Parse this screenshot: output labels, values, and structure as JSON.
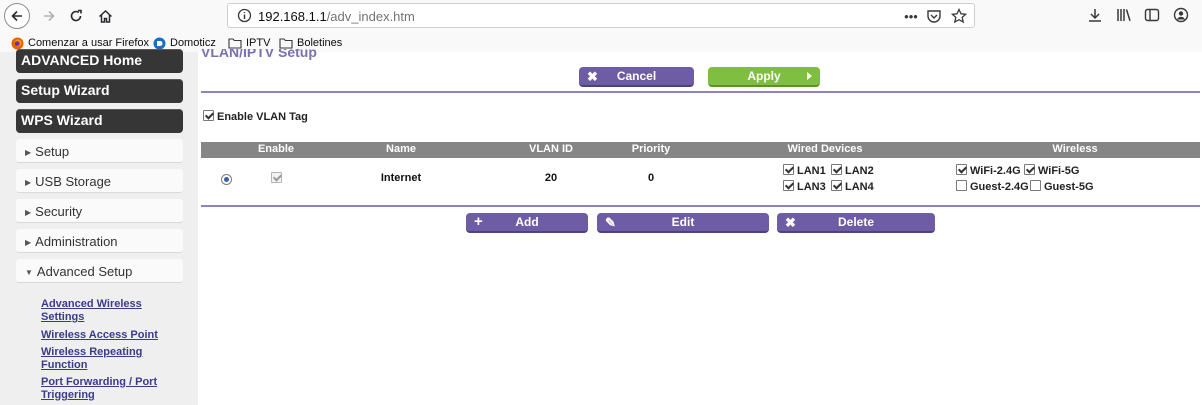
{
  "browser": {
    "url_host": "192.168.1.1",
    "url_path": "/adv_index.htm",
    "bookmarks": [
      {
        "label": "Comenzar a usar Firefox",
        "icon": "firefox-icon"
      },
      {
        "label": "Domoticz",
        "icon": "domoticz-icon"
      },
      {
        "label": "IPTV",
        "icon": "folder-icon"
      },
      {
        "label": "Boletines",
        "icon": "folder-icon"
      }
    ],
    "page_actions_label": "•••"
  },
  "sidebar": {
    "primary": [
      "ADVANCED Home",
      "Setup Wizard",
      "WPS Wizard"
    ],
    "sections": [
      "Setup",
      "USB Storage",
      "Security",
      "Administration",
      "Advanced Setup"
    ],
    "sublinks": [
      {
        "line1": "Advanced Wireless",
        "line2": "Settings"
      },
      {
        "line1": "Wireless Access Point",
        "line2": ""
      },
      {
        "line1": "Wireless Repeating",
        "line2": "Function"
      },
      {
        "line1": "Port Forwarding / Port",
        "line2": "Triggering"
      }
    ]
  },
  "content": {
    "title": "VLAN/IPTV Setup",
    "cancel_label": "Cancel",
    "apply_label": "Apply",
    "enable_vlan_tag_label": "Enable VLAN Tag",
    "enable_vlan_tag_checked": true,
    "table": {
      "headers": [
        "Enable",
        "Name",
        "VLAN ID",
        "Priority",
        "Wired Devices",
        "Wireless"
      ],
      "rows": [
        {
          "selected": true,
          "enabled": true,
          "name": "Internet",
          "vlan_id": "20",
          "priority": "0",
          "wired": [
            {
              "label": "LAN1",
              "checked": true
            },
            {
              "label": "LAN2",
              "checked": true
            },
            {
              "label": "LAN3",
              "checked": true
            },
            {
              "label": "LAN4",
              "checked": true
            }
          ],
          "wireless": [
            {
              "label": "WiFi-2.4G",
              "checked": true
            },
            {
              "label": "WiFi-5G",
              "checked": true
            },
            {
              "label": "Guest-2.4G",
              "checked": false
            },
            {
              "label": "Guest-5G",
              "checked": false
            }
          ]
        }
      ]
    },
    "add_label": "Add",
    "edit_label": "Edit",
    "delete_label": "Delete"
  },
  "colors": {
    "accent_purple": "#6e5ca5",
    "accent_green": "#7fbe3f",
    "title_purple": "#7a6fb1",
    "header_gray": "#868686",
    "menu_dark": "#363636"
  }
}
